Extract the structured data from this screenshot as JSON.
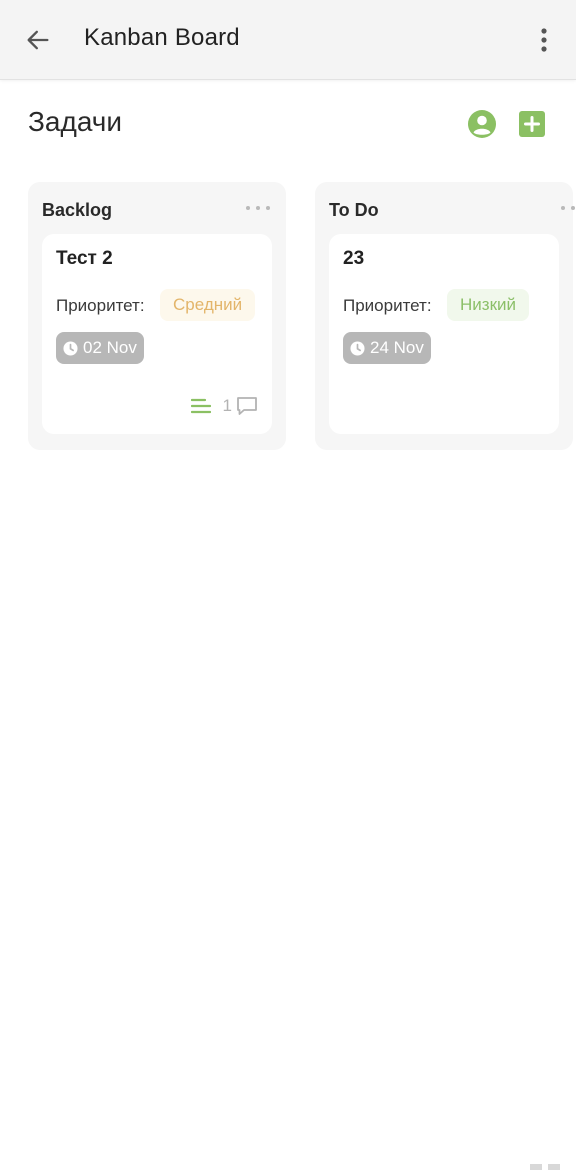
{
  "appbar": {
    "title": "Kanban Board"
  },
  "page": {
    "heading": "Задачи"
  },
  "columns": [
    {
      "name": "Backlog",
      "cards": [
        {
          "title": "Тест 2",
          "priority_label": "Приоритет:",
          "priority": "Средний",
          "date": "02 Nov",
          "comments": "1"
        }
      ]
    },
    {
      "name": "To Do",
      "cards": [
        {
          "title": "23",
          "priority_label": "Приоритет:",
          "priority": "Низкий",
          "date": "24 Nov"
        }
      ]
    }
  ],
  "colors": {
    "accent_green": "#8bc063",
    "priority_medium_text": "#e3b56a",
    "priority_medium_bg": "#fdf8ec",
    "priority_low_text": "#8bbf68",
    "priority_low_bg": "#f1f8ec",
    "date_chip_bg": "#b7b7b7"
  },
  "icons": {
    "back": "arrow-left-icon",
    "more": "more-vertical-icon",
    "user": "user-circle-icon",
    "add": "plus-square-icon",
    "column_menu": "more-horizontal-icon",
    "clock": "clock-icon",
    "description": "lines-icon",
    "comment": "comment-icon"
  }
}
